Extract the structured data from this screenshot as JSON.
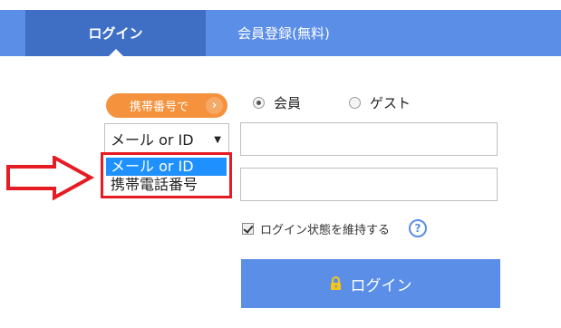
{
  "tabs": {
    "login": "ログイン",
    "register": "会員登録(無料)"
  },
  "phone_switch": {
    "label": "携帯番号で",
    "chevron": "›"
  },
  "user_type": {
    "member": "会員",
    "guest": "ゲスト",
    "selected": "member"
  },
  "id_type_select": {
    "value": "メール or ID",
    "options": [
      "メール or ID",
      "携帯電話番号"
    ],
    "highlighted": "メール or ID"
  },
  "fields": {
    "id_value": "",
    "password_value": ""
  },
  "keep_login": {
    "label": "ログイン状態を維持する",
    "checked": true,
    "help_symbol": "?"
  },
  "login_button": {
    "label": "ログイン",
    "icon": "lock-icon"
  },
  "colors": {
    "primary": "#5b8ee7",
    "active_tab": "#3f6fc4",
    "orange": "#f4923d",
    "annotation_red": "#e51c23",
    "selection_blue": "#1e90ff",
    "lock_yellow": "#f5c518"
  }
}
